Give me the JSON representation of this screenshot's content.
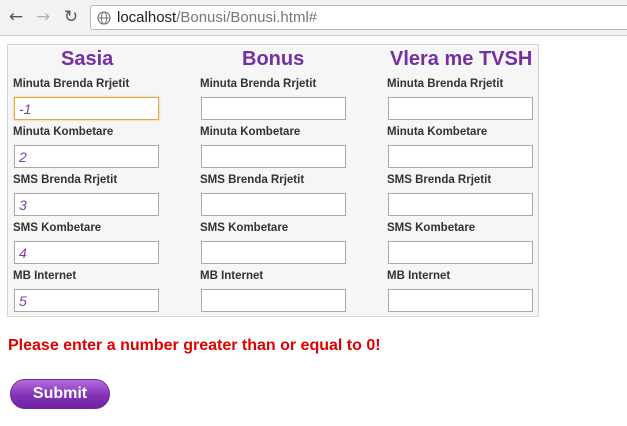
{
  "browser": {
    "url_host": "localhost",
    "url_path": "/Bonusi/Bonusi.html#"
  },
  "form": {
    "columns": [
      {
        "title": "Sasia",
        "fields": [
          {
            "label": "Minuta Brenda Rrjetit",
            "value": "-1"
          },
          {
            "label": "Minuta Kombetare",
            "value": "2"
          },
          {
            "label": "SMS Brenda Rrjetit",
            "value": "3"
          },
          {
            "label": "SMS Kombetare",
            "value": "4"
          },
          {
            "label": "MB Internet",
            "value": "5"
          }
        ]
      },
      {
        "title": "Bonus",
        "fields": [
          {
            "label": "Minuta Brenda Rrjetit",
            "value": ""
          },
          {
            "label": "Minuta Kombetare",
            "value": ""
          },
          {
            "label": "SMS Brenda Rrjetit",
            "value": ""
          },
          {
            "label": "SMS Kombetare",
            "value": ""
          },
          {
            "label": "MB Internet",
            "value": ""
          }
        ]
      },
      {
        "title": "Vlera me TVSH",
        "fields": [
          {
            "label": "Minuta Brenda Rrjetit",
            "value": ""
          },
          {
            "label": "Minuta Kombetare",
            "value": ""
          },
          {
            "label": "SMS Brenda Rrjetit",
            "value": ""
          },
          {
            "label": "SMS Kombetare",
            "value": ""
          },
          {
            "label": "MB Internet",
            "value": ""
          }
        ]
      }
    ],
    "error_message": "Please enter a number greater than or equal to 0!",
    "submit_label": "Submit"
  },
  "colors": {
    "accent": "#7430a3",
    "error": "#e00000"
  }
}
